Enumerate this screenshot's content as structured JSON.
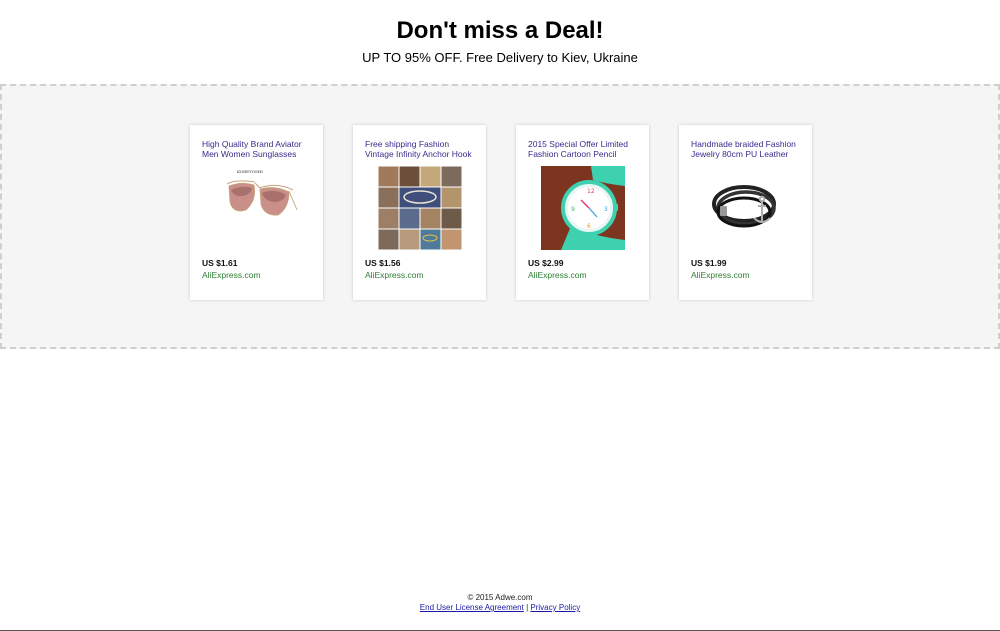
{
  "header": {
    "headline": "Don't miss a Deal!",
    "subline": "UP TO 95% OFF. Free Delivery to Kiev, Ukraine"
  },
  "deals": [
    {
      "title": "High Quality Brand Aviator Men Women Sunglasses",
      "price": "US $1.61",
      "source": "AliExpress.com",
      "image_icon": "aviator-sunglasses-image",
      "image_caption": "KOREYOSHI"
    },
    {
      "title": "Free shipping Fashion Vintage Infinity Anchor Hook",
      "price": "US $1.56",
      "source": "AliExpress.com",
      "image_icon": "bracelet-collage-image"
    },
    {
      "title": "2015 Special Offer Limited Fashion Cartoon Pencil",
      "price": "US $2.99",
      "source": "AliExpress.com",
      "image_icon": "cartoon-watch-image"
    },
    {
      "title": "Handmade braided Fashion Jewelry 80cm PU Leather",
      "price": "US $1.99",
      "source": "AliExpress.com",
      "image_icon": "leather-anchor-bracelet-image"
    }
  ],
  "footer": {
    "copyright": "© 2015 Adwe.com",
    "eula_label": "End User License Agreement",
    "separator": "|",
    "privacy_label": "Privacy Policy"
  },
  "colors": {
    "title_link": "#3a2a8c",
    "source_green": "#2e7d32",
    "deals_background": "#f5f5f5"
  }
}
